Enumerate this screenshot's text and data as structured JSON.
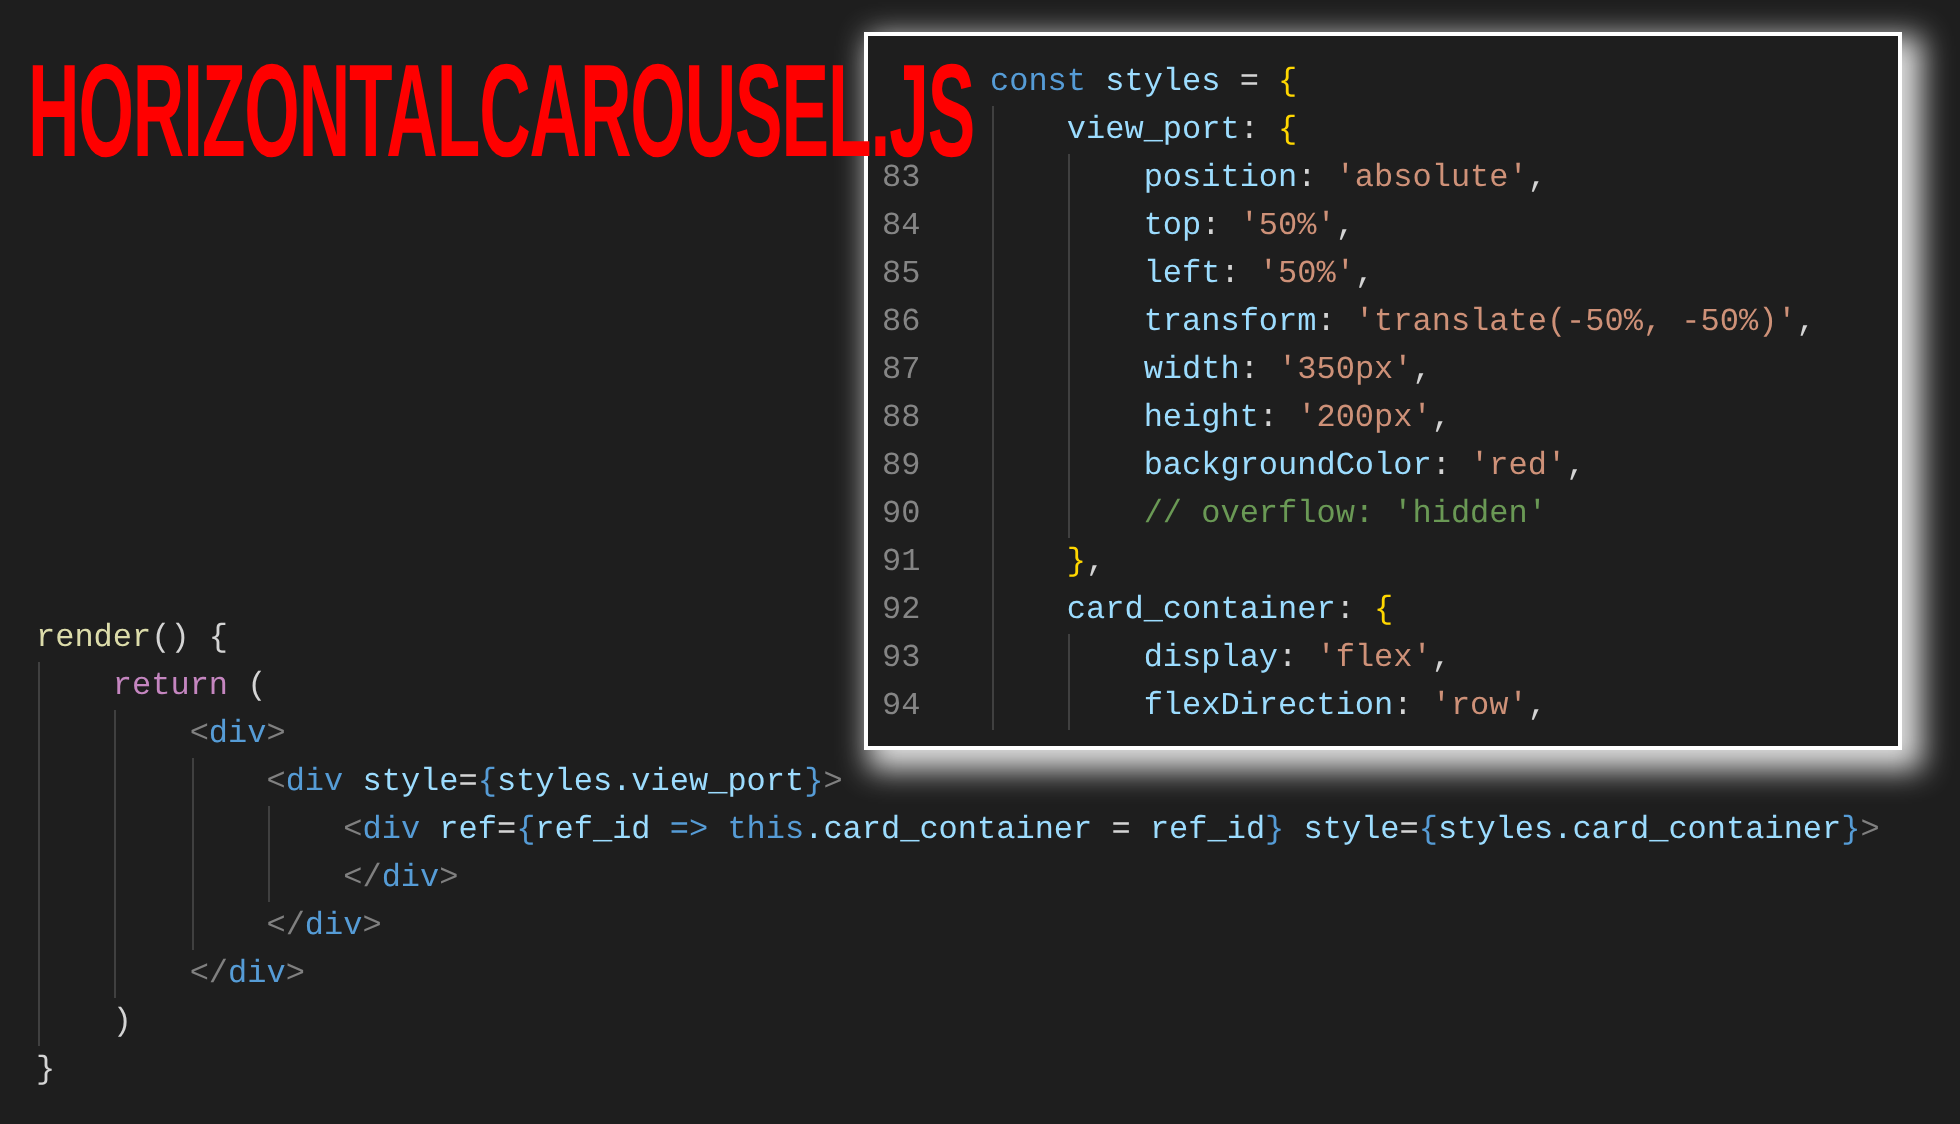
{
  "title": "HORIZONTALCAROUSEL.JS",
  "main_code": {
    "lines": [
      {
        "tokens": [
          {
            "text": "render",
            "kind": "function"
          },
          {
            "text": "() {",
            "kind": "punct"
          }
        ]
      },
      {
        "tokens": [
          {
            "text": "    return",
            "kind": "control"
          },
          {
            "text": " (",
            "kind": "punct"
          }
        ]
      },
      {
        "tokens": [
          {
            "text": "        <",
            "kind": "angle"
          },
          {
            "text": "div",
            "kind": "tag"
          },
          {
            "text": ">",
            "kind": "angle"
          }
        ]
      },
      {
        "tokens": [
          {
            "text": "            <",
            "kind": "angle"
          },
          {
            "text": "div",
            "kind": "tag"
          },
          {
            "text": " style",
            "kind": "prop"
          },
          {
            "text": "=",
            "kind": "punct"
          },
          {
            "text": "{",
            "kind": "keyword"
          },
          {
            "text": "styles.view_port",
            "kind": "prop"
          },
          {
            "text": "}",
            "kind": "keyword"
          },
          {
            "text": ">",
            "kind": "angle"
          }
        ]
      },
      {
        "tokens": [
          {
            "text": "                <",
            "kind": "angle"
          },
          {
            "text": "div",
            "kind": "tag"
          },
          {
            "text": " ref",
            "kind": "prop"
          },
          {
            "text": "=",
            "kind": "punct"
          },
          {
            "text": "{",
            "kind": "keyword"
          },
          {
            "text": "ref_id",
            "kind": "prop"
          },
          {
            "text": " => ",
            "kind": "keyword"
          },
          {
            "text": "this",
            "kind": "keyword"
          },
          {
            "text": ".card_container",
            "kind": "prop"
          },
          {
            "text": " = ",
            "kind": "punct"
          },
          {
            "text": "ref_id",
            "kind": "prop"
          },
          {
            "text": "}",
            "kind": "keyword"
          },
          {
            "text": " style",
            "kind": "prop"
          },
          {
            "text": "=",
            "kind": "punct"
          },
          {
            "text": "{",
            "kind": "keyword"
          },
          {
            "text": "styles.card_container",
            "kind": "prop"
          },
          {
            "text": "}",
            "kind": "keyword"
          },
          {
            "text": ">",
            "kind": "angle"
          }
        ]
      },
      {
        "tokens": [
          {
            "text": "                </",
            "kind": "angle"
          },
          {
            "text": "div",
            "kind": "tag"
          },
          {
            "text": ">",
            "kind": "angle"
          }
        ]
      },
      {
        "tokens": [
          {
            "text": "            </",
            "kind": "angle"
          },
          {
            "text": "div",
            "kind": "tag"
          },
          {
            "text": ">",
            "kind": "angle"
          }
        ]
      },
      {
        "tokens": [
          {
            "text": "        </",
            "kind": "angle"
          },
          {
            "text": "div",
            "kind": "tag"
          },
          {
            "text": ">",
            "kind": "angle"
          }
        ]
      },
      {
        "tokens": [
          {
            "text": "    )",
            "kind": "punct"
          }
        ]
      },
      {
        "tokens": [
          {
            "text": "}",
            "kind": "punct"
          }
        ]
      }
    ]
  },
  "popup_code": {
    "lines": [
      {
        "tokens": [
          {
            "text": "const",
            "kind": "keyword"
          },
          {
            "text": " styles",
            "kind": "prop"
          },
          {
            "text": " = ",
            "kind": "punct"
          },
          {
            "text": "{",
            "kind": "brace"
          }
        ]
      },
      {
        "tokens": [
          {
            "text": "    view_port",
            "kind": "prop"
          },
          {
            "text": ": ",
            "kind": "punct"
          },
          {
            "text": "{",
            "kind": "brace"
          }
        ]
      },
      {
        "number": "83",
        "tokens": [
          {
            "text": "        position",
            "kind": "prop"
          },
          {
            "text": ": ",
            "kind": "punct"
          },
          {
            "text": "'absolute'",
            "kind": "string"
          },
          {
            "text": ",",
            "kind": "punct"
          }
        ]
      },
      {
        "number": "84",
        "tokens": [
          {
            "text": "        top",
            "kind": "prop"
          },
          {
            "text": ": ",
            "kind": "punct"
          },
          {
            "text": "'50%'",
            "kind": "string"
          },
          {
            "text": ",",
            "kind": "punct"
          }
        ]
      },
      {
        "number": "85",
        "tokens": [
          {
            "text": "        left",
            "kind": "prop"
          },
          {
            "text": ": ",
            "kind": "punct"
          },
          {
            "text": "'50%'",
            "kind": "string"
          },
          {
            "text": ",",
            "kind": "punct"
          }
        ]
      },
      {
        "number": "86",
        "tokens": [
          {
            "text": "        transform",
            "kind": "prop"
          },
          {
            "text": ": ",
            "kind": "punct"
          },
          {
            "text": "'translate(-50%, -50%)'",
            "kind": "string"
          },
          {
            "text": ",",
            "kind": "punct"
          }
        ]
      },
      {
        "number": "87",
        "tokens": [
          {
            "text": "        width",
            "kind": "prop"
          },
          {
            "text": ": ",
            "kind": "punct"
          },
          {
            "text": "'350px'",
            "kind": "string"
          },
          {
            "text": ",",
            "kind": "punct"
          }
        ]
      },
      {
        "number": "88",
        "tokens": [
          {
            "text": "        height",
            "kind": "prop"
          },
          {
            "text": ": ",
            "kind": "punct"
          },
          {
            "text": "'200px'",
            "kind": "string"
          },
          {
            "text": ",",
            "kind": "punct"
          }
        ]
      },
      {
        "number": "89",
        "tokens": [
          {
            "text": "        backgroundColor",
            "kind": "prop"
          },
          {
            "text": ": ",
            "kind": "punct"
          },
          {
            "text": "'red'",
            "kind": "string"
          },
          {
            "text": ",",
            "kind": "punct"
          }
        ]
      },
      {
        "number": "90",
        "tokens": [
          {
            "text": "        // overflow: 'hidden'",
            "kind": "comment"
          }
        ]
      },
      {
        "number": "91",
        "tokens": [
          {
            "text": "    }",
            "kind": "brace"
          },
          {
            "text": ",",
            "kind": "punct"
          }
        ]
      },
      {
        "number": "92",
        "tokens": [
          {
            "text": "    card_container",
            "kind": "prop"
          },
          {
            "text": ": ",
            "kind": "punct"
          },
          {
            "text": "{",
            "kind": "brace"
          }
        ]
      },
      {
        "number": "93",
        "tokens": [
          {
            "text": "        display",
            "kind": "prop"
          },
          {
            "text": ": ",
            "kind": "punct"
          },
          {
            "text": "'flex'",
            "kind": "string"
          },
          {
            "text": ",",
            "kind": "punct"
          }
        ]
      },
      {
        "number": "94",
        "tokens": [
          {
            "text": "        flexDirection",
            "kind": "prop"
          },
          {
            "text": ": ",
            "kind": "punct"
          },
          {
            "text": "'row'",
            "kind": "string"
          },
          {
            "text": ",",
            "kind": "punct"
          }
        ]
      }
    ]
  }
}
